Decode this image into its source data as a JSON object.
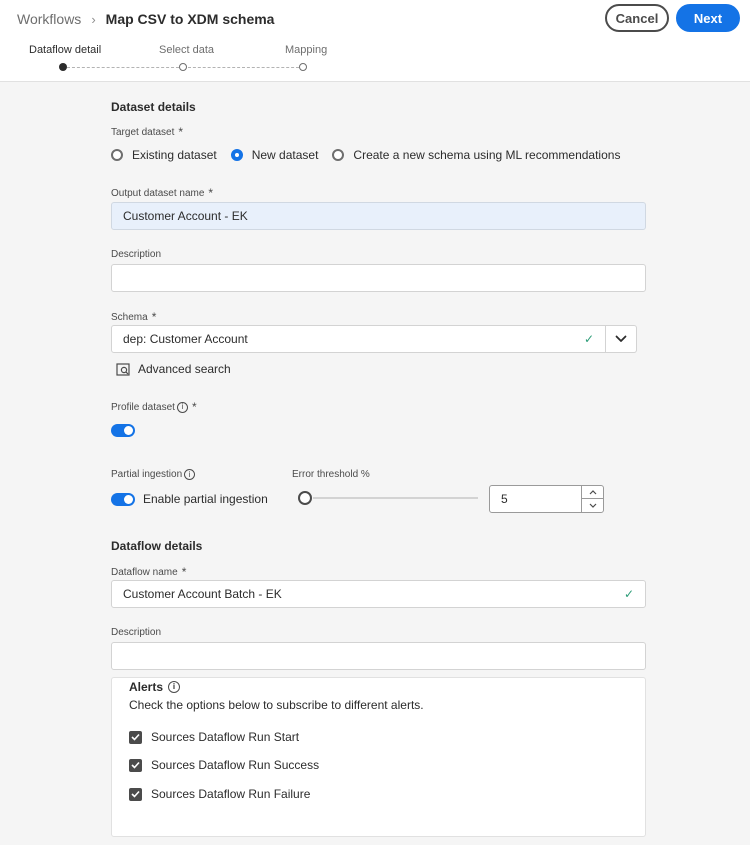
{
  "header": {
    "breadcrumb_root": "Workflows",
    "breadcrumb_separator": "›",
    "title": "Map CSV to XDM schema",
    "cancel_label": "Cancel",
    "next_label": "Next"
  },
  "steps": [
    {
      "label": "Dataflow detail",
      "state": "current"
    },
    {
      "label": "Select data",
      "state": "pending"
    },
    {
      "label": "Mapping",
      "state": "pending"
    }
  ],
  "dataset": {
    "section_title": "Dataset details",
    "target_label": "Target dataset",
    "options": [
      {
        "label": "Existing dataset",
        "checked": false
      },
      {
        "label": "New dataset",
        "checked": true
      },
      {
        "label": "Create a new schema using ML recommendations",
        "checked": false
      }
    ],
    "output_name_label": "Output dataset name",
    "output_name_value": "Customer Account - EK",
    "description_label": "Description",
    "description_value": "",
    "schema_label": "Schema",
    "schema_value": "dep: Customer Account",
    "advanced_search_label": "Advanced search",
    "profile_label": "Profile dataset",
    "profile_enabled": true,
    "partial_label": "Partial ingestion",
    "partial_toggle_label": "Enable partial ingestion",
    "partial_enabled": true,
    "threshold_label": "Error threshold %",
    "threshold_value": "5",
    "threshold_slider_fraction": 0.0
  },
  "dataflow": {
    "section_title": "Dataflow details",
    "name_label": "Dataflow name",
    "name_value": "Customer Account Batch - EK",
    "description_label": "Description",
    "description_value": ""
  },
  "alerts": {
    "title": "Alerts",
    "description": "Check the options below to subscribe to different alerts.",
    "items": [
      {
        "label": "Sources Dataflow Run Start",
        "checked": true
      },
      {
        "label": "Sources Dataflow Run Success",
        "checked": true
      },
      {
        "label": "Sources Dataflow Run Failure",
        "checked": true
      }
    ]
  },
  "colors": {
    "accent": "#1473e6",
    "valid": "#2d9d78",
    "highlight_field": "#e8f0fb"
  }
}
